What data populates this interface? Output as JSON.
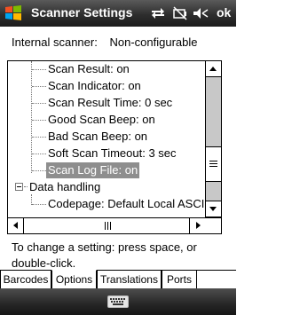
{
  "titlebar": {
    "title": "Scanner Settings",
    "ok_label": "ok",
    "icons": [
      "windows-logo-icon",
      "connectivity-icon",
      "battery-icon",
      "volume-icon"
    ]
  },
  "scanner": {
    "label": "Internal scanner:",
    "value": "Non-configurable"
  },
  "tree": {
    "items": [
      {
        "label": "Scan Result: on",
        "selected": false
      },
      {
        "label": "Scan Indicator: on",
        "selected": false
      },
      {
        "label": "Scan Result Time: 0 sec",
        "selected": false
      },
      {
        "label": "Good Scan Beep: on",
        "selected": false
      },
      {
        "label": "Bad Scan Beep: on",
        "selected": false
      },
      {
        "label": "Soft Scan Timeout: 3 sec",
        "selected": false
      },
      {
        "label": "Scan Log File: on",
        "selected": true
      }
    ],
    "group": {
      "label": "Data handling",
      "expanded": true
    },
    "group_items": [
      {
        "label": "Codepage: Default Local ASCII"
      }
    ]
  },
  "hint": "To change a setting: press space, or double-click.",
  "tabs": [
    {
      "label": "Barcodes",
      "active": false
    },
    {
      "label": "Options",
      "active": true
    },
    {
      "label": "Translations",
      "active": false
    },
    {
      "label": "Ports",
      "active": false
    }
  ],
  "bottombar": {
    "icon": "keyboard-icon"
  },
  "colors": {
    "titlebar": "#2e2e2e",
    "selection": "#8e8e8e",
    "scroll_track": "#c8c8c8"
  }
}
